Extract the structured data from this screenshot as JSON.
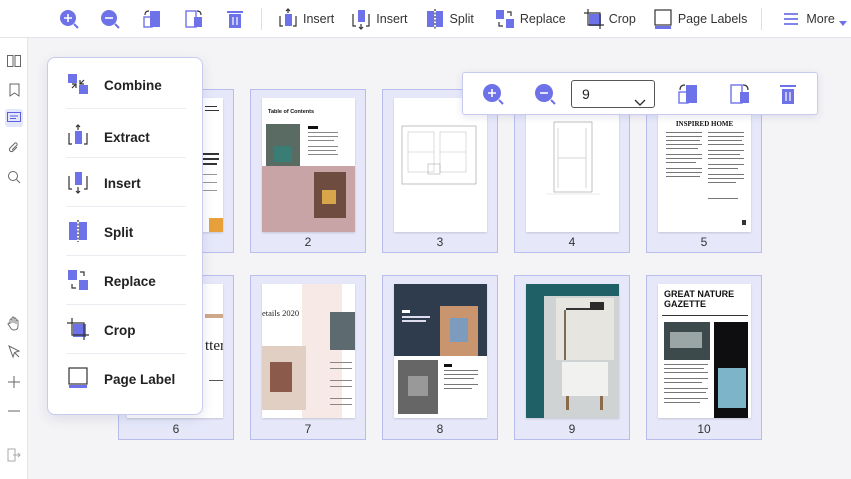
{
  "toolbar": {
    "insert_label": "Insert",
    "insert2_label": "Insert",
    "split_label": "Split",
    "replace_label": "Replace",
    "crop_label": "Crop",
    "page_labels_label": "Page Labels",
    "more_label": "More"
  },
  "menu": {
    "items": [
      {
        "label": "Combine",
        "icon": "combine-icon"
      },
      {
        "label": "Extract",
        "icon": "extract-icon"
      },
      {
        "label": "Insert",
        "icon": "insert-icon"
      },
      {
        "label": "Split",
        "icon": "split-icon"
      },
      {
        "label": "Replace",
        "icon": "replace-icon"
      },
      {
        "label": "Crop",
        "icon": "crop-icon"
      },
      {
        "label": "Page Label",
        "icon": "page-label-icon"
      }
    ]
  },
  "float_toolbar": {
    "zoom_value": "9"
  },
  "pages": [
    {
      "number": "2",
      "heading": "Table of Contents"
    },
    {
      "number": "3"
    },
    {
      "number": "4"
    },
    {
      "number": "5",
      "heading": "INSPIRED HOME"
    },
    {
      "number": "6",
      "heading": "ttery rksh"
    },
    {
      "number": "7",
      "heading": "etails 2020"
    },
    {
      "number": "8"
    },
    {
      "number": "9"
    },
    {
      "number": "10",
      "heading": "GREAT NATURE GAZETTE"
    }
  ],
  "colors": {
    "accent": "#5b5fe0",
    "selection_fill": "#e6e8fa",
    "selection_border": "#b9bdee"
  }
}
